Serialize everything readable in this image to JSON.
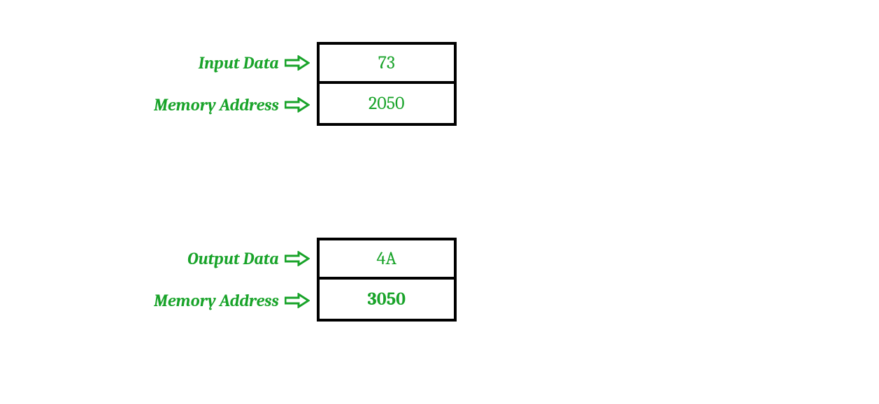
{
  "input_group": {
    "label1": "Input Data",
    "value1": "73",
    "label2": "Memory Address",
    "value2": "2050"
  },
  "output_group": {
    "label1": "Output Data",
    "value1": "4A",
    "label2": "Memory Address",
    "value2": "3050"
  },
  "colors": {
    "accent": "#18a329",
    "border": "#000000"
  }
}
